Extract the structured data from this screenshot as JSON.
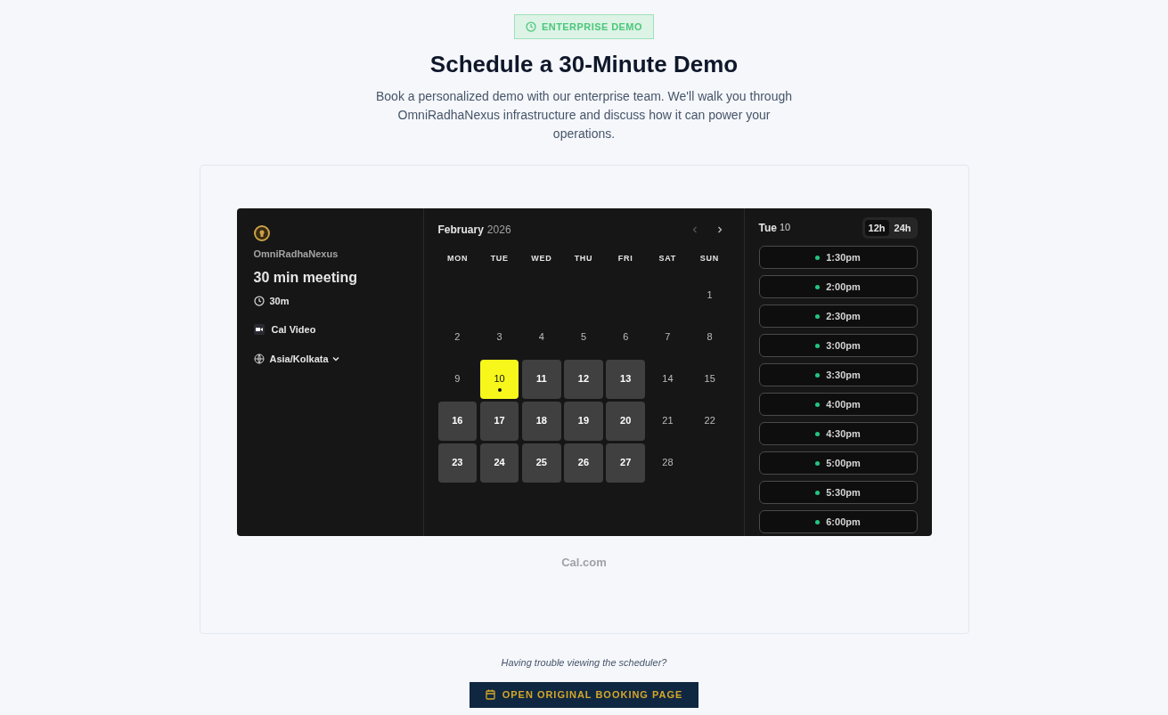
{
  "badge": "ENTERPRISE DEMO",
  "title": "Schedule a 30-Minute Demo",
  "intro": "Book a personalized demo with our enterprise team. We'll walk you through OmniRadhaNexus infrastructure and discuss how it can power your operations.",
  "booker": {
    "profile": {
      "name": "OmniRadhaNexus",
      "event": "30 min meeting",
      "duration": "30m",
      "location": "Cal Video",
      "timezone": "Asia/Kolkata"
    },
    "calendar": {
      "month": "February",
      "year": "2026",
      "weekdays": [
        "MON",
        "TUE",
        "WED",
        "THU",
        "FRI",
        "SAT",
        "SUN"
      ],
      "weeks": [
        {
          "days": [
            {
              "label": "1",
              "available": false,
              "selected": false
            }
          ]
        },
        {
          "days": [
            {
              "label": "2",
              "available": false,
              "selected": false
            },
            {
              "label": "3",
              "available": false,
              "selected": false
            },
            {
              "label": "4",
              "available": false,
              "selected": false
            },
            {
              "label": "5",
              "available": false,
              "selected": false
            },
            {
              "label": "6",
              "available": false,
              "selected": false
            },
            {
              "label": "7",
              "available": false,
              "selected": false
            },
            {
              "label": "8",
              "available": false,
              "selected": false
            }
          ]
        },
        {
          "days": [
            {
              "label": "9",
              "available": false,
              "selected": false
            },
            {
              "label": "10",
              "available": true,
              "selected": true
            },
            {
              "label": "11",
              "available": true,
              "selected": false
            },
            {
              "label": "12",
              "available": true,
              "selected": false
            },
            {
              "label": "13",
              "available": true,
              "selected": false
            },
            {
              "label": "14",
              "available": false,
              "selected": false
            },
            {
              "label": "15",
              "available": false,
              "selected": false
            }
          ]
        },
        {
          "days": [
            {
              "label": "16",
              "available": true,
              "selected": false
            },
            {
              "label": "17",
              "available": true,
              "selected": false
            },
            {
              "label": "18",
              "available": true,
              "selected": false
            },
            {
              "label": "19",
              "available": true,
              "selected": false
            },
            {
              "label": "20",
              "available": true,
              "selected": false
            },
            {
              "label": "21",
              "available": false,
              "selected": false
            },
            {
              "label": "22",
              "available": false,
              "selected": false
            }
          ]
        },
        {
          "days": [
            {
              "label": "23",
              "available": true,
              "selected": false
            },
            {
              "label": "24",
              "available": true,
              "selected": false
            },
            {
              "label": "25",
              "available": true,
              "selected": false
            },
            {
              "label": "26",
              "available": true,
              "selected": false
            },
            {
              "label": "27",
              "available": true,
              "selected": false
            },
            {
              "label": "28",
              "available": false,
              "selected": false
            }
          ]
        }
      ]
    },
    "slots": {
      "day_name": "Tue",
      "day_number": "10",
      "formats": [
        {
          "label": "12h",
          "selected": true
        },
        {
          "label": "24h",
          "selected": false
        }
      ],
      "times": [
        "1:30pm",
        "2:00pm",
        "2:30pm",
        "3:00pm",
        "3:30pm",
        "4:00pm",
        "4:30pm",
        "5:00pm",
        "5:30pm",
        "6:00pm"
      ]
    },
    "branding": "Cal.com"
  },
  "help_text": "Having trouble viewing the scheduler?",
  "open_button": "OPEN ORIGINAL BOOKING PAGE"
}
